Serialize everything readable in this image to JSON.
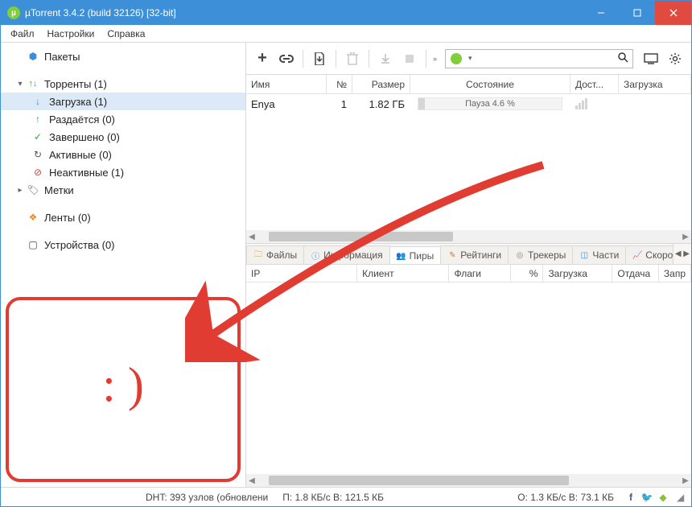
{
  "titlebar": {
    "title": "µTorrent 3.4.2  (build 32126) [32-bit]"
  },
  "menu": {
    "file": "Файл",
    "settings": "Настройки",
    "help": "Справка"
  },
  "sidebar": {
    "packets": "Пакеты",
    "torrents": "Торренты (1)",
    "downloading": "Загрузка (1)",
    "seeding": "Раздаётся (0)",
    "completed": "Завершено (0)",
    "active": "Активные (0)",
    "inactive": "Неактивные (1)",
    "labels": "Метки",
    "feeds": "Ленты (0)",
    "devices": "Устройства (0)"
  },
  "annotation": {
    "smiley": ": )"
  },
  "table": {
    "headers": {
      "name": "Имя",
      "num": "№",
      "size": "Размер",
      "state": "Состояние",
      "avail": "Дост...",
      "download": "Загрузка"
    },
    "rows": [
      {
        "name": "Enya",
        "num": "1",
        "size": "1.82 ГБ",
        "state": "Пауза 4.6 %",
        "progress_pct": 4.6
      }
    ]
  },
  "tabs": {
    "files": "Файлы",
    "info": "Информация",
    "peers": "Пиры",
    "ratings": "Рейтинги",
    "trackers": "Трекеры",
    "pieces": "Части",
    "speed": "Скорост"
  },
  "peer_headers": {
    "ip": "IP",
    "client": "Клиент",
    "flags": "Флаги",
    "pct": "%",
    "down": "Загрузка",
    "up": "Отдача",
    "req": "Запр"
  },
  "statusbar": {
    "dht": "DHT: 393 узлов  (обновлени",
    "pb": "П: 1.8 КБ/с В: 121.5 КБ",
    "ob": "О: 1.3 КБ/с В: 73.1 КБ"
  },
  "search": {
    "placeholder": ""
  }
}
